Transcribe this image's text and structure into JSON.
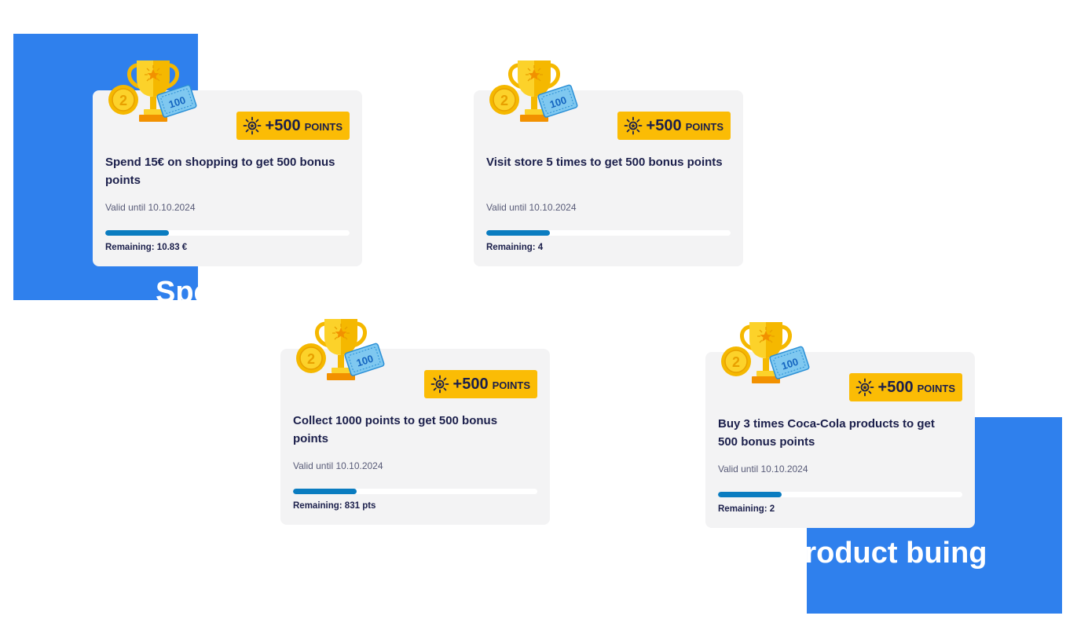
{
  "background_text": {
    "first": "Spend",
    "second": "Product buing"
  },
  "colors": {
    "accent_blue": "#2f80ed",
    "badge_yellow": "#fbbc05",
    "progress_blue": "#0a7cc0",
    "card_bg": "#f3f3f4",
    "text_dark": "#1b1f4b"
  },
  "cards": [
    {
      "badge_amount": "+500",
      "badge_unit": "POINTS",
      "title": "Spend 15€ on shopping to get 500 bonus points",
      "valid": "Valid until 10.10.2024",
      "progress": 0.26,
      "remaining": "Remaining: 10.83 €"
    },
    {
      "badge_amount": "+500",
      "badge_unit": "POINTS",
      "title": "Visit store 5 times to get 500 bonus points",
      "valid": "Valid until 10.10.2024",
      "progress": 0.26,
      "remaining": "Remaining: 4"
    },
    {
      "badge_amount": "+500",
      "badge_unit": "POINTS",
      "title": "Collect 1000 points to get 500 bonus points",
      "valid": "Valid until 10.10.2024",
      "progress": 0.26,
      "remaining": "Remaining: 831 pts"
    },
    {
      "badge_amount": "+500",
      "badge_unit": "POINTS",
      "title": "Buy 3 times Coca-Cola products to get 500 bonus points",
      "valid": "Valid until 10.10.2024",
      "progress": 0.26,
      "remaining": "Remaining: 2"
    }
  ],
  "icons": {
    "trophy": "trophy-coin-ticket-icon",
    "badge": "sun-points-icon"
  }
}
